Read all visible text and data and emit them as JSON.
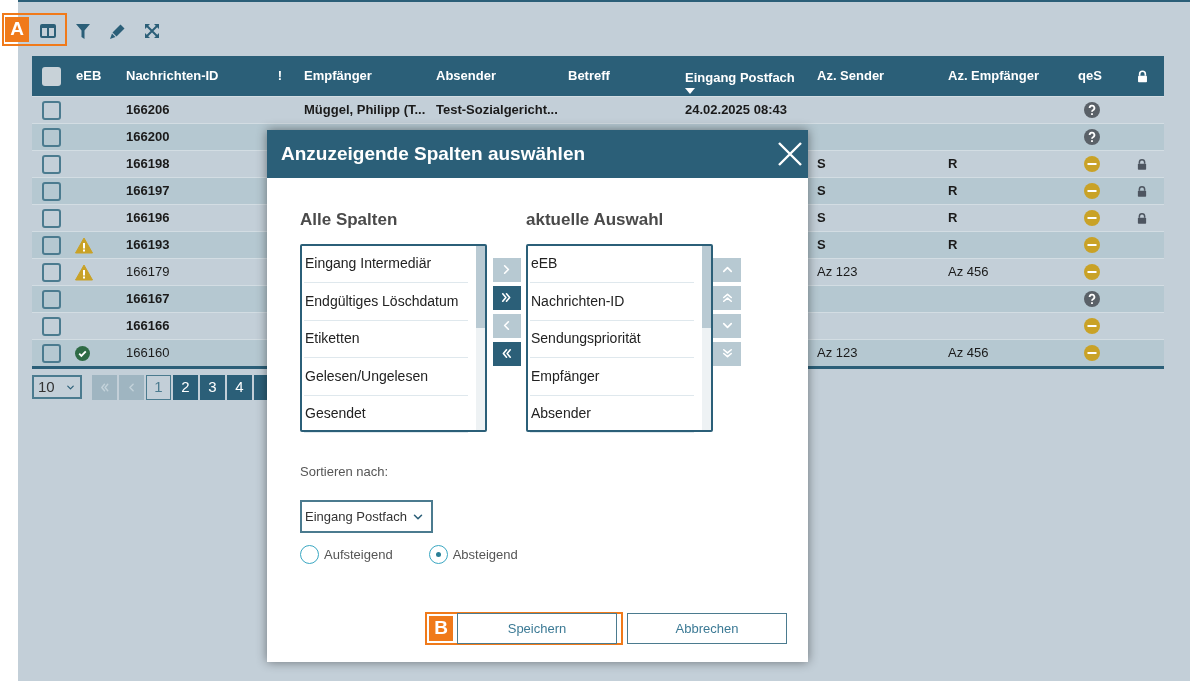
{
  "toolbar": {
    "marker": "A"
  },
  "table": {
    "columns": [
      {
        "kind": "checkbox",
        "checked": false
      },
      {
        "kind": "text",
        "label": "eEB",
        "sorted": false
      },
      {
        "kind": "text",
        "label": "Nachrichten-ID",
        "sorted": false
      },
      {
        "kind": "text",
        "label": "!",
        "sorted": false
      },
      {
        "kind": "text",
        "label": "Empfänger",
        "sorted": false
      },
      {
        "kind": "text",
        "label": "Absender",
        "sorted": false
      },
      {
        "kind": "text",
        "label": "Betreff",
        "sorted": false
      },
      {
        "kind": "text",
        "label": "Eingang Postfach",
        "sorted": true
      },
      {
        "kind": "text",
        "label": "Az. Sender",
        "sorted": false
      },
      {
        "kind": "text",
        "label": "Az. Empfänger",
        "sorted": false
      },
      {
        "kind": "text",
        "label": "qeS",
        "sorted": false
      },
      {
        "kind": "lock"
      }
    ],
    "rows": [
      {
        "checked": false,
        "unread": true,
        "id": "166206",
        "empfaenger": "Müggel, Philipp (T...",
        "absender": "Test-Sozialgericht...",
        "eingang": "24.02.2025 08:43",
        "qes": {
          "kind": "unknown"
        },
        "locked": false
      },
      {
        "checked": false,
        "unread": true,
        "id": "166200",
        "qes": {
          "kind": "unknown"
        },
        "locked": false
      },
      {
        "checked": false,
        "unread": true,
        "id": "166198",
        "az_sender": "S",
        "az_empfaenger": "R",
        "qes": {
          "kind": "pending"
        },
        "locked": true
      },
      {
        "checked": false,
        "unread": true,
        "id": "166197",
        "az_sender": "S",
        "az_empfaenger": "R",
        "qes": {
          "kind": "pending"
        },
        "locked": true
      },
      {
        "checked": false,
        "unread": true,
        "id": "166196",
        "az_sender": "S",
        "az_empfaenger": "R",
        "qes": {
          "kind": "pending"
        },
        "locked": true
      },
      {
        "checked": false,
        "unread": true,
        "eeb": {
          "kind": "warning"
        },
        "id": "166193",
        "az_sender": "S",
        "az_empfaenger": "R",
        "qes": {
          "kind": "pending"
        },
        "locked": false
      },
      {
        "checked": false,
        "unread": false,
        "eeb": {
          "kind": "warning"
        },
        "id": "166179",
        "az_sender": "Az 123",
        "az_empfaenger": "Az 456",
        "qes": {
          "kind": "pending"
        },
        "locked": false
      },
      {
        "checked": false,
        "unread": true,
        "id": "166167",
        "qes": {
          "kind": "unknown"
        },
        "locked": false
      },
      {
        "checked": false,
        "unread": true,
        "id": "166166",
        "qes": {
          "kind": "pending"
        },
        "locked": false
      },
      {
        "checked": false,
        "unread": false,
        "eeb": {
          "kind": "ok"
        },
        "id": "166160",
        "az_sender": "Az 123",
        "az_empfaenger": "Az 456",
        "qes": {
          "kind": "pending"
        },
        "locked": false
      }
    ]
  },
  "pagination": {
    "page_size": "10",
    "first_disabled": true,
    "prev_disabled": true,
    "pages": [
      {
        "label": "1",
        "selected": true
      },
      {
        "label": "2",
        "selected": false
      },
      {
        "label": "3",
        "selected": false
      },
      {
        "label": "4",
        "selected": false
      },
      {
        "selected": false
      }
    ]
  },
  "dialog": {
    "title": "Anzuzeigende Spalten auswählen",
    "available_title": "Alle Spalten",
    "available": [
      "Eingang Intermediär",
      "Endgültiges Löschdatum",
      "Etiketten",
      "Gelesen/Ungelesen",
      "Gesendet"
    ],
    "current_title": "aktuelle Auswahl",
    "current": [
      "eEB",
      "Nachrichten-ID",
      "Sendungspriorität",
      "Empfänger",
      "Absender"
    ],
    "move_buttons": [
      {
        "kind": "add",
        "disabled": true
      },
      {
        "kind": "add_all",
        "disabled": false
      },
      {
        "kind": "remove",
        "disabled": true
      },
      {
        "kind": "remove_all",
        "disabled": false
      }
    ],
    "order_buttons": [
      {
        "kind": "up",
        "disabled": true
      },
      {
        "kind": "top",
        "disabled": true
      },
      {
        "kind": "down",
        "disabled": true
      },
      {
        "kind": "bottom",
        "disabled": true
      }
    ],
    "sort_label": "Sortieren nach:",
    "sort_value": "Eingang Postfach",
    "order_options": [
      {
        "label": "Aufsteigend",
        "selected": false
      },
      {
        "label": "Absteigend",
        "selected": true
      }
    ],
    "save": "Speichern",
    "cancel": "Abbrechen",
    "save_marker": "B"
  }
}
